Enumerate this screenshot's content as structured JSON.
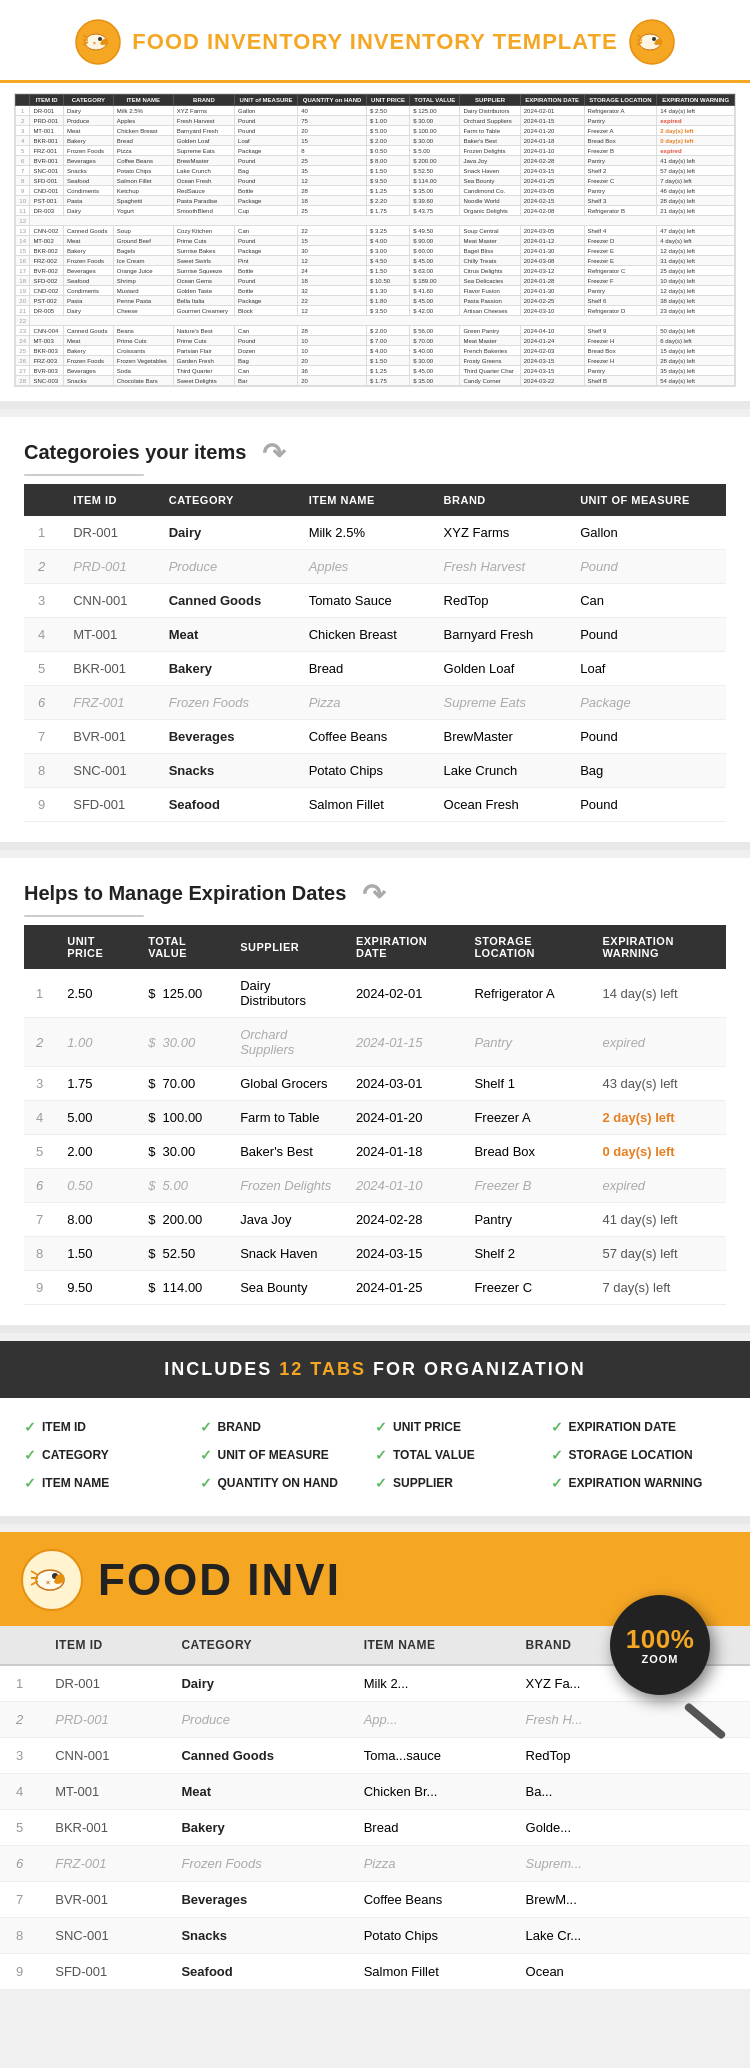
{
  "header": {
    "title_normal": "FOOD INVENTORY",
    "title_highlight": "",
    "title_suffix": "TEMPLATE"
  },
  "spreadsheet": {
    "columns": [
      "ITEM ID",
      "CATEGORY",
      "ITEM NAME",
      "BRAND",
      "UNIT of MEASURE",
      "QUANTITY on HAND",
      "UNIT PRICE",
      "TOTAL VALUE",
      "SUPPLIER",
      "EXPIRATION DATE",
      "STORAGE LOCATION",
      "EXPIRATION WARNING"
    ],
    "rows": [
      [
        "DR-001",
        "Dairy",
        "Milk 2.5%",
        "XYZ Farms",
        "Gallon",
        "40",
        "$",
        "2.50",
        "$",
        "125.00",
        "Dairy Distributors",
        "2024-02-01",
        "Refrigerator A",
        "14 day(s) left"
      ],
      [
        "PRD-001",
        "Produce",
        "Apples",
        "Fresh Harvest",
        "Pound",
        "75",
        "$",
        "1.00",
        "$",
        "30.00",
        "Orchard Suppliers",
        "2024-01-15",
        "Pantry",
        "expired"
      ],
      [
        "MT-001",
        "Meat",
        "Chicken Breast",
        "Barnyard Fresh",
        "Pound",
        "20",
        "$",
        "5.00",
        "$",
        "100.00",
        "Farm to Table",
        "2024-01-20",
        "Freezer A",
        "2 day(s) left"
      ],
      [
        "BKR-001",
        "Bakery",
        "Bread",
        "Golden Loaf",
        "Loaf",
        "15",
        "$",
        "2.00",
        "$",
        "30.00",
        "Baker's Best",
        "2024-01-18",
        "Bread Box",
        "0 day(s) left"
      ],
      [
        "FRZ-001",
        "Frozen Foods",
        "Pizza",
        "Supreme Eats",
        "Package",
        "8",
        "$",
        "0.50",
        "$",
        "5.00",
        "Frozen Delights",
        "2024-01-10",
        "Freezer B",
        "expired"
      ],
      [
        "BVR-001",
        "Beverages",
        "Coffee Beans",
        "BrewMaster",
        "Pound",
        "25",
        "$",
        "8.00",
        "$",
        "200.00",
        "Java Joy",
        "2024-02-28",
        "Pantry",
        "41 day(s) left"
      ],
      [
        "SNC-001",
        "Snacks",
        "Potato Chips",
        "Lake Crunch",
        "Bag",
        "35",
        "$",
        "1.50",
        "$",
        "52.50",
        "Snack Haven",
        "2024-03-15",
        "Shelf 2",
        "57 day(s) left"
      ],
      [
        "SFD-001",
        "Seafood",
        "Salmon Fillet",
        "Ocean Fresh",
        "Pound",
        "12",
        "$",
        "9.50",
        "$",
        "114.00",
        "Sea Bounty",
        "2024-01-25",
        "Freezer C",
        "7 day(s) left"
      ],
      [
        "CND-001",
        "Condiments",
        "Ketchup",
        "RedSauce",
        "Bottle",
        "28",
        "$",
        "1.25",
        "$",
        "35.00",
        "Candimond Co.",
        "2024-03-05",
        "Pantry",
        "46 day(s) left"
      ],
      [
        "PST-001",
        "Pasta",
        "Spaghetti",
        "Pasta Paradise",
        "Package",
        "18",
        "$",
        "2.20",
        "$",
        "39.60",
        "Noodle World",
        "2024-02-15",
        "Shelf 3",
        "28 day(s) left"
      ],
      [
        "DR-003",
        "Dairy",
        "Yogurt",
        "SmoothBlend",
        "Cup",
        "25",
        "$",
        "1.75",
        "$",
        "43.75",
        "Organic Delights",
        "2024-02-08",
        "Refrigerator B",
        "21 day(s) left"
      ],
      [
        "",
        "",
        "",
        "",
        "",
        "",
        "",
        "",
        "",
        "",
        "",
        ""
      ],
      [
        "CNN-002",
        "Canned Goods",
        "Soup",
        "Cozy Kitchen",
        "Can",
        "22",
        "$",
        "3.25",
        "$",
        "49.50",
        "Soup Central",
        "2024-03-05",
        "Shelf 4",
        "47 day(s) left"
      ],
      [
        "MT-002",
        "Meat",
        "Ground Beef",
        "Prime Cuts",
        "Pound",
        "15",
        "$",
        "4.00",
        "$",
        "90.00",
        "Meat Master",
        "2024-01-12",
        "Freezer D",
        "4 day(s) left"
      ],
      [
        "BKR-002",
        "Bakery",
        "Bagels",
        "Sunrise Bakes",
        "Package",
        "30",
        "$",
        "3.00",
        "$",
        "60.00",
        "Bagel Bliss",
        "2024-01-30",
        "Freezer E",
        "12 day(s) left"
      ],
      [
        "FRZ-002",
        "Frozen Foods",
        "Ice Cream",
        "Sweet Swirls",
        "Pint",
        "12",
        "$",
        "4.50",
        "$",
        "45.00",
        "Chilly Treats",
        "2024-03-08",
        "Freezer E",
        "31 day(s) left"
      ],
      [
        "BVR-002",
        "Beverages",
        "Orange Juice",
        "Sunrise Squeeze",
        "Bottle",
        "24",
        "$",
        "1.50",
        "$",
        "63.00",
        "Citrus Delights",
        "2024-03-12",
        "Refrigerator C",
        "25 day(s) left"
      ],
      [
        "SFD-002",
        "Seafood",
        "Shrimp",
        "Ocean Gems",
        "Pound",
        "18",
        "$",
        "10.50",
        "$",
        "189.00",
        "Sea Delicacies",
        "2024-01-28",
        "Freezer F",
        "10 day(s) left"
      ],
      [
        "CND-002",
        "Condiments",
        "Mustard",
        "Golden Taste",
        "Bottle",
        "32",
        "$",
        "1.30",
        "$",
        "41.60",
        "Flavor Fusion",
        "2024-01-30",
        "Pantry",
        "12 day(s) left"
      ],
      [
        "PST-002",
        "Pasta",
        "Penne Pasta",
        "Bella Italia",
        "Package",
        "22",
        "$",
        "1.80",
        "$",
        "45.00",
        "Pasta Passion",
        "2024-02-25",
        "Shelf 6",
        "38 day(s) left"
      ],
      [
        "DR-005",
        "Dairy",
        "Cheese",
        "Gourmet Creamery",
        "Block",
        "12",
        "$",
        "3.50",
        "$",
        "42.00",
        "Artisan Cheeses",
        "2024-03-10",
        "Refrigerator D",
        "23 day(s) left"
      ],
      [
        "",
        "",
        "",
        "",
        "",
        "",
        "",
        "",
        "",
        "",
        "",
        ""
      ],
      [
        "CNN-004",
        "Canned Goods",
        "Beans",
        "Nature's Best",
        "Can",
        "28",
        "$",
        "2.00",
        "$",
        "56.00",
        "Green Pantry",
        "2024-04-10",
        "Shelf 9",
        "50 day(s) left"
      ],
      [
        "MT-003",
        "Meat",
        "Prime Cuts",
        "Prime Cuts",
        "Pound",
        "10",
        "$",
        "7.00",
        "$",
        "70.00",
        "Meat Master",
        "2024-01-24",
        "Freezer H",
        "6 day(s) left"
      ],
      [
        "BKR-003",
        "Bakery",
        "Croissants",
        "Parisian Flair",
        "Dozen",
        "10",
        "$",
        "4.00",
        "$",
        "40.00",
        "French Bakeries",
        "2024-02-03",
        "Bread Box",
        "15 day(s) left"
      ],
      [
        "FRZ-003",
        "Frozen Foods",
        "Frozen Vegetables",
        "Garden Fresh",
        "Bag",
        "20",
        "$",
        "1.50",
        "$",
        "30.00",
        "Frosty Greens",
        "2024-03-15",
        "Freezer H",
        "28 day(s) left"
      ],
      [
        "BVR-003",
        "Beverages",
        "Soda",
        "Third Quarter",
        "Can",
        "36",
        "$",
        "1.25",
        "$",
        "45.00",
        "Third Quarter Char",
        "2024-03-15",
        "Pantry",
        "35 day(s) left"
      ],
      [
        "SNC-003",
        "Snacks",
        "Chocolate Bars",
        "Sweet Delights",
        "Bar",
        "20",
        "$",
        "1.75",
        "$",
        "35.00",
        "Candy Corner",
        "2024-03-22",
        "Shelf B",
        "54 day(s) left"
      ]
    ]
  },
  "section1": {
    "title": "Categoroies your items",
    "columns": [
      "ITEM ID",
      "CATEGORY",
      "ITEM NAME",
      "BRAND",
      "UNIT of MEASURE"
    ],
    "rows": [
      {
        "num": "1",
        "id": "DR-001",
        "italic": false,
        "category": "Dairy",
        "category_style": "bold",
        "name": "Milk 2.5%",
        "brand": "XYZ Farms",
        "unit": "Gallon"
      },
      {
        "num": "2",
        "id": "PRD-001",
        "italic": true,
        "category": "Produce",
        "category_style": "italic",
        "name": "Apples",
        "brand": "Fresh Harvest",
        "unit": "Pound"
      },
      {
        "num": "3",
        "id": "CNN-001",
        "italic": false,
        "category": "Canned Goods",
        "category_style": "bold",
        "name": "Tomato Sauce",
        "brand": "RedTop",
        "unit": "Can"
      },
      {
        "num": "4",
        "id": "MT-001",
        "italic": false,
        "category": "Meat",
        "category_style": "bold",
        "name": "Chicken Breast",
        "brand": "Barnyard Fresh",
        "unit": "Pound"
      },
      {
        "num": "5",
        "id": "BKR-001",
        "italic": false,
        "category": "Bakery",
        "category_style": "bold",
        "name": "Bread",
        "brand": "Golden Loaf",
        "unit": "Loaf"
      },
      {
        "num": "6",
        "id": "FRZ-001",
        "italic": true,
        "category": "Frozen Foods",
        "category_style": "italic",
        "name": "Pizza",
        "brand": "Supreme Eats",
        "unit": "Package"
      },
      {
        "num": "7",
        "id": "BVR-001",
        "italic": false,
        "category": "Beverages",
        "category_style": "bold",
        "name": "Coffee Beans",
        "brand": "BrewMaster",
        "unit": "Pound"
      },
      {
        "num": "8",
        "id": "SNC-001",
        "italic": false,
        "category": "Snacks",
        "category_style": "bold",
        "name": "Potato Chips",
        "brand": "Lake Crunch",
        "unit": "Bag"
      },
      {
        "num": "9",
        "id": "SFD-001",
        "italic": false,
        "category": "Seafood",
        "category_style": "bold",
        "name": "Salmon Fillet",
        "brand": "Ocean Fresh",
        "unit": "Pound"
      }
    ]
  },
  "section2": {
    "title": "Helps to Manage Expiration Dates",
    "columns": [
      "UNIT PRICE",
      "TOTAL VALUE",
      "SUPPLIER",
      "EXPIRATION DATE",
      "STORAGE LOCATION",
      "EXPIRATION WARNING"
    ],
    "rows": [
      {
        "num": "1",
        "italic": false,
        "price": "2.50",
        "total_prefix": "$",
        "total": "125.00",
        "supplier": "Dairy Distributors",
        "exp_date": "2024-02-01",
        "storage": "Refrigerator A",
        "warning": "14 day(s) left",
        "warn_style": "normal"
      },
      {
        "num": "2",
        "italic": true,
        "price": "1.00",
        "total_prefix": "$",
        "total": "30.00",
        "supplier": "Orchard Suppliers",
        "exp_date": "2024-01-15",
        "storage": "Pantry",
        "warning": "expired",
        "warn_style": "red"
      },
      {
        "num": "3",
        "italic": false,
        "price": "1.75",
        "total_prefix": "$",
        "total": "70.00",
        "supplier": "Global Grocers",
        "exp_date": "2024-03-01",
        "storage": "Shelf 1",
        "warning": "43 day(s) left",
        "warn_style": "normal"
      },
      {
        "num": "4",
        "italic": false,
        "price": "5.00",
        "total_prefix": "$",
        "total": "100.00",
        "supplier": "Farm to Table",
        "exp_date": "2024-01-20",
        "storage": "Freezer A",
        "warning": "2 day(s) left",
        "warn_style": "orange"
      },
      {
        "num": "5",
        "italic": false,
        "price": "2.00",
        "total_prefix": "$",
        "total": "30.00",
        "supplier": "Baker's Best",
        "exp_date": "2024-01-18",
        "storage": "Bread Box",
        "warning": "0 day(s) left",
        "warn_style": "orange"
      },
      {
        "num": "6",
        "italic": true,
        "price": "0.50",
        "total_prefix": "$",
        "total": "5.00",
        "supplier": "Frozen Delights",
        "exp_date": "2024-01-10",
        "storage": "Freezer B",
        "warning": "expired",
        "warn_style": "red"
      },
      {
        "num": "7",
        "italic": false,
        "price": "8.00",
        "total_prefix": "$",
        "total": "200.00",
        "supplier": "Java Joy",
        "exp_date": "2024-02-28",
        "storage": "Pantry",
        "warning": "41 day(s) left",
        "warn_style": "normal"
      },
      {
        "num": "8",
        "italic": false,
        "price": "1.50",
        "total_prefix": "$",
        "total": "52.50",
        "supplier": "Snack Haven",
        "exp_date": "2024-03-15",
        "storage": "Shelf 2",
        "warning": "57 day(s) left",
        "warn_style": "normal"
      },
      {
        "num": "9",
        "italic": false,
        "price": "9.50",
        "total_prefix": "$",
        "total": "114.00",
        "supplier": "Sea Bounty",
        "exp_date": "2024-01-25",
        "storage": "Freezer C",
        "warning": "7 day(s) left",
        "warn_style": "normal"
      }
    ]
  },
  "banner": {
    "text_normal": "INCLUDES",
    "highlight": "12 TABS",
    "text_suffix": "FOR ORGANIZATION"
  },
  "features_grid": {
    "items": [
      "ITEM ID",
      "BRAND",
      "UNIT PRICE",
      "EXPIRATION DATE",
      "CATEGORY",
      "UNIT OF MEASURE",
      "TOTAL VALUE",
      "STORAGE LOCATION",
      "ITEM NAME",
      "QUANTITY ON HAND",
      "SUPPLIER",
      "EXPIRATION WARNING"
    ]
  },
  "promo": {
    "title": "FOOD INVI"
  },
  "bottom_table": {
    "columns": [
      "ITEM ID",
      "CATEGORY",
      "ITEM NAME",
      "BRAND"
    ],
    "rows": [
      {
        "num": "1",
        "id": "DR-001",
        "italic": false,
        "category": "Dairy",
        "name": "Milk 2...",
        "brand": "XYZ Fa..."
      },
      {
        "num": "2",
        "id": "PRD-001",
        "italic": true,
        "category": "Produce",
        "name": "App...",
        "brand": "Fresh H..."
      },
      {
        "num": "3",
        "id": "CNN-001",
        "italic": false,
        "category": "Canned Goods",
        "name": "Toma...sauce",
        "brand": "RedTop"
      },
      {
        "num": "4",
        "id": "MT-001",
        "italic": false,
        "category": "Meat",
        "name": "Chicken Br...",
        "brand": "Ba..."
      },
      {
        "num": "5",
        "id": "BKR-001",
        "italic": false,
        "category": "Bakery",
        "name": "Bread",
        "brand": "Golde..."
      },
      {
        "num": "6",
        "id": "FRZ-001",
        "italic": true,
        "category": "Frozen Foods",
        "name": "Pizza",
        "brand": "Suprem..."
      },
      {
        "num": "7",
        "id": "BVR-001",
        "italic": false,
        "category": "Beverages",
        "name": "Coffee Beans",
        "brand": "BrewM..."
      },
      {
        "num": "8",
        "id": "SNC-001",
        "italic": false,
        "category": "Snacks",
        "name": "Potato Chips",
        "brand": "Lake Cr..."
      },
      {
        "num": "9",
        "id": "SFD-001",
        "italic": false,
        "category": "Seafood",
        "name": "Salmon Fillet",
        "brand": "Ocean"
      }
    ]
  }
}
